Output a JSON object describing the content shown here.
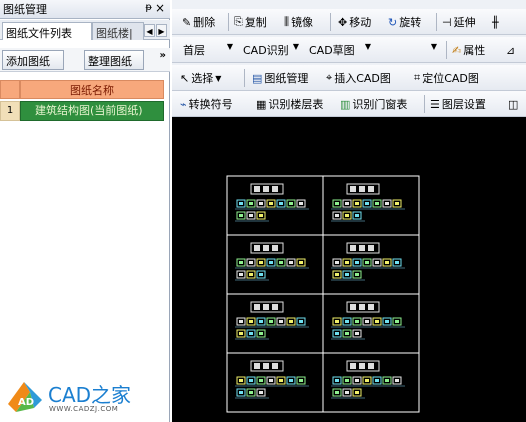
{
  "left_panel": {
    "title": "图纸管理",
    "pin": "ᵽ",
    "close": "×",
    "tabs": [
      {
        "label": "图纸文件列表",
        "active": true
      },
      {
        "label": "图纸楼|",
        "active": false
      }
    ],
    "tab_arrows": [
      "◀",
      "▶"
    ],
    "buttons": {
      "add": "添加图纸",
      "organize": "整理图纸"
    },
    "more": "»",
    "grid": {
      "header": "图纸名称",
      "rows": [
        {
          "num": "1",
          "name": "建筑结构图(当前图纸)"
        }
      ]
    }
  },
  "toolbar": {
    "row1": [
      {
        "icon": "pencil-icon",
        "glyph": "✎",
        "label": "删除"
      },
      {
        "icon": "copy-icon",
        "glyph": "⎘",
        "label": "复制"
      },
      {
        "icon": "mirror-icon",
        "glyph": "⫼",
        "label": "镜像"
      },
      {
        "icon": "move-icon",
        "glyph": "✥",
        "label": "移动"
      },
      {
        "icon": "rotate-icon",
        "glyph": "↻",
        "label": "旋转"
      },
      {
        "icon": "extend-icon",
        "glyph": "⊣",
        "label": "延伸"
      }
    ],
    "row2": {
      "floor": "首层",
      "cad_recognize": "CAD识别",
      "cad_draft": "CAD草图",
      "properties": "属性"
    },
    "row3": {
      "select": "选择",
      "drawing_manage": "图纸管理",
      "insert_cad": "插入CAD图",
      "locate_cad": "定位CAD图"
    },
    "row4": {
      "convert_symbol": "转换符号",
      "recognize_floor_table": "识别楼层表",
      "recognize_door_window": "识别门窗表",
      "layer_settings": "图层设置"
    }
  },
  "logo": {
    "text": "CAD之家",
    "url": "WWW.CADZJ.COM"
  },
  "colors": {
    "canvas_bg": "#000000",
    "drawing_frame": "#ffffff",
    "accent_header": "#f7a87c",
    "selected_row": "#2f8f3e",
    "logo_blue": "#1b7fd0"
  }
}
